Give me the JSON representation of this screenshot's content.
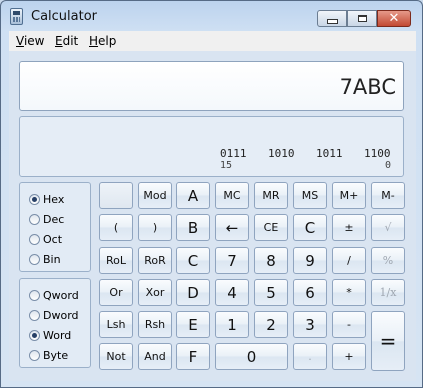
{
  "window": {
    "title": "Calculator"
  },
  "menu": [
    {
      "label_first": "V",
      "label_rest": "iew"
    },
    {
      "label_first": "E",
      "label_rest": "dit"
    },
    {
      "label_first": "H",
      "label_rest": "elp"
    }
  ],
  "display": {
    "value": "7ABC"
  },
  "bits": [
    {
      "group": "0111",
      "index": "15"
    },
    {
      "group": "1010",
      "index": ""
    },
    {
      "group": "1011",
      "index": ""
    },
    {
      "group": "1100",
      "index": "0"
    }
  ],
  "radix": {
    "options": [
      "Hex",
      "Dec",
      "Oct",
      "Bin"
    ],
    "selected": "Hex"
  },
  "word_size": {
    "options": [
      "Qword",
      "Dword",
      "Word",
      "Byte"
    ],
    "selected": "Word"
  },
  "keys": [
    [
      "",
      "Mod",
      "A",
      "MC",
      "MR",
      "MS",
      "M+",
      "M-"
    ],
    [
      "(",
      ")",
      "B",
      "←",
      "CE",
      "C",
      "±",
      "√"
    ],
    [
      "RoL",
      "RoR",
      "C",
      "7",
      "8",
      "9",
      "/",
      "%"
    ],
    [
      "Or",
      "Xor",
      "D",
      "4",
      "5",
      "6",
      "*",
      "1/x"
    ],
    [
      "Lsh",
      "Rsh",
      "E",
      "1",
      "2",
      "3",
      "-",
      "="
    ],
    [
      "Not",
      "And",
      "F",
      "0",
      ".",
      "+"
    ]
  ],
  "disabled_keys": [
    "√",
    "%",
    "1/x",
    "."
  ],
  "colors": {
    "title_close": "#c24a33",
    "window_frame": "#bcd3ee",
    "client_bg": "#d9e4f1"
  },
  "icons": {
    "app": "calculator-icon",
    "min": "minimize-icon",
    "max": "maximize-icon",
    "close": "close-icon",
    "backspace": "backspace-arrow-icon"
  }
}
